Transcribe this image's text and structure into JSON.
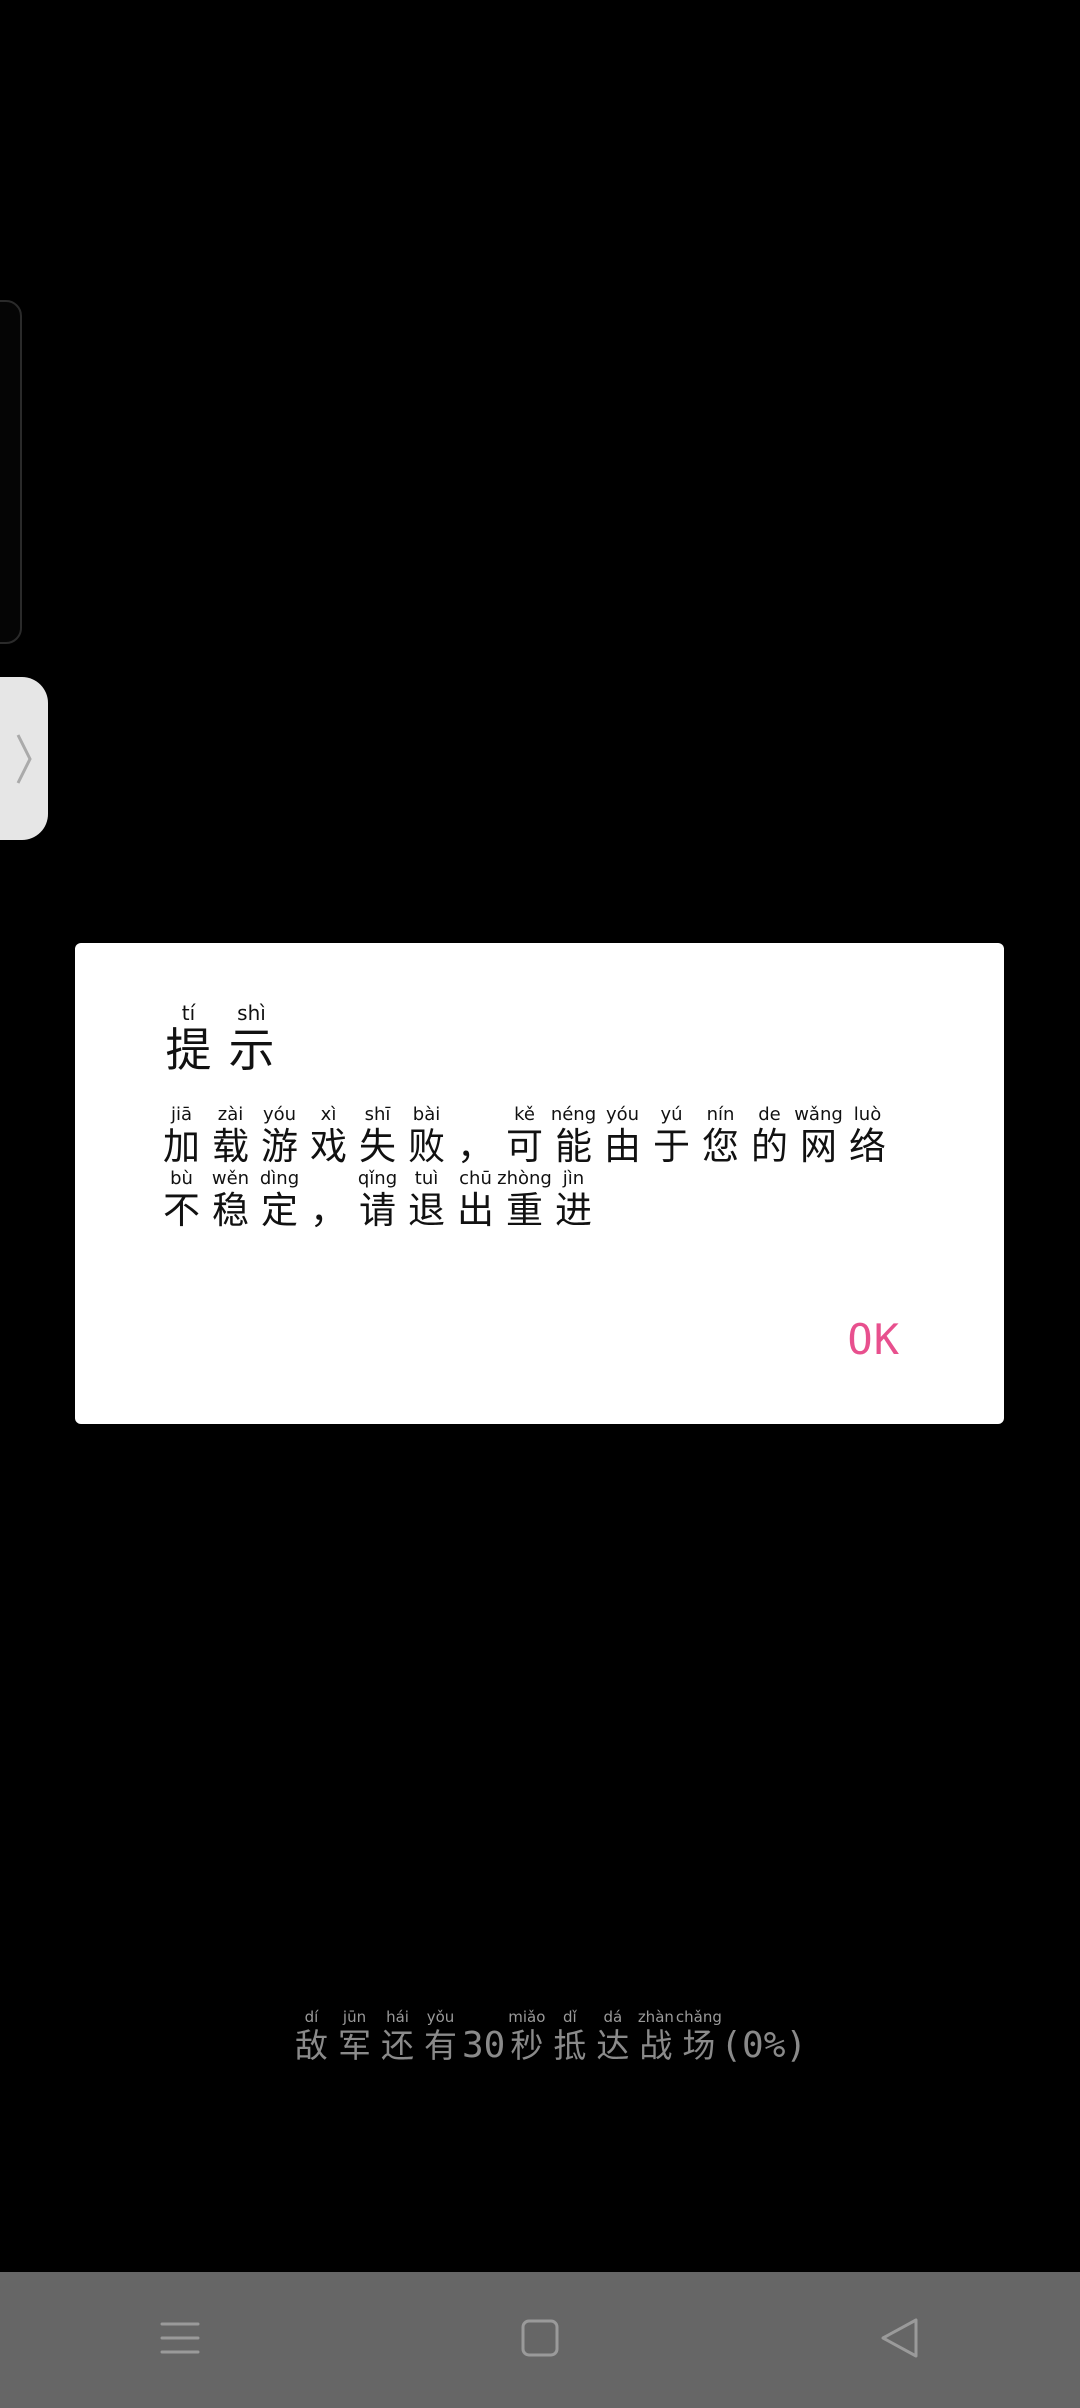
{
  "dialog": {
    "title": [
      {
        "py": "tí",
        "hz": "提"
      },
      {
        "py": "shì",
        "hz": "示"
      }
    ],
    "message_line1": [
      {
        "py": "jiā",
        "hz": "加"
      },
      {
        "py": "zài",
        "hz": "载"
      },
      {
        "py": "yóu",
        "hz": "游"
      },
      {
        "py": "xì",
        "hz": "戏"
      },
      {
        "py": "shī",
        "hz": "失"
      },
      {
        "py": "bài",
        "hz": "败"
      },
      {
        "py": "",
        "hz": "，"
      },
      {
        "py": "kě",
        "hz": "可"
      },
      {
        "py": "néng",
        "hz": "能"
      },
      {
        "py": "yóu",
        "hz": "由"
      },
      {
        "py": "yú",
        "hz": "于"
      },
      {
        "py": "nín",
        "hz": "您"
      },
      {
        "py": "de",
        "hz": "的"
      },
      {
        "py": "wǎng",
        "hz": "网"
      },
      {
        "py": "luò",
        "hz": "络"
      }
    ],
    "message_line2": [
      {
        "py": "bù",
        "hz": "不"
      },
      {
        "py": "wěn",
        "hz": "稳"
      },
      {
        "py": "dìng",
        "hz": "定"
      },
      {
        "py": "",
        "hz": "，"
      },
      {
        "py": "qǐng",
        "hz": "请"
      },
      {
        "py": "tuì",
        "hz": "退"
      },
      {
        "py": "chū",
        "hz": "出"
      },
      {
        "py": "zhòng",
        "hz": "重"
      },
      {
        "py": "jìn",
        "hz": "进"
      }
    ],
    "ok_label": "OK",
    "accent_color": "#e8508e"
  },
  "loading": {
    "part1": [
      {
        "py": "dí",
        "hz": "敌"
      },
      {
        "py": "jūn",
        "hz": "军"
      },
      {
        "py": "hái",
        "hz": "还"
      },
      {
        "py": "yǒu",
        "hz": "有"
      }
    ],
    "seconds": "30",
    "part2": [
      {
        "py": "miǎo",
        "hz": "秒"
      },
      {
        "py": "dǐ",
        "hz": "抵"
      },
      {
        "py": "dá",
        "hz": "达"
      },
      {
        "py": "zhàn",
        "hz": "战"
      },
      {
        "py": "chǎng",
        "hz": "场"
      }
    ],
    "progress_text": "(0%)"
  },
  "side_tab_icon": "chevron-right-icon",
  "navbar": {
    "menu_icon": "menu-icon",
    "home_icon": "home-square-icon",
    "back_icon": "back-triangle-icon"
  }
}
